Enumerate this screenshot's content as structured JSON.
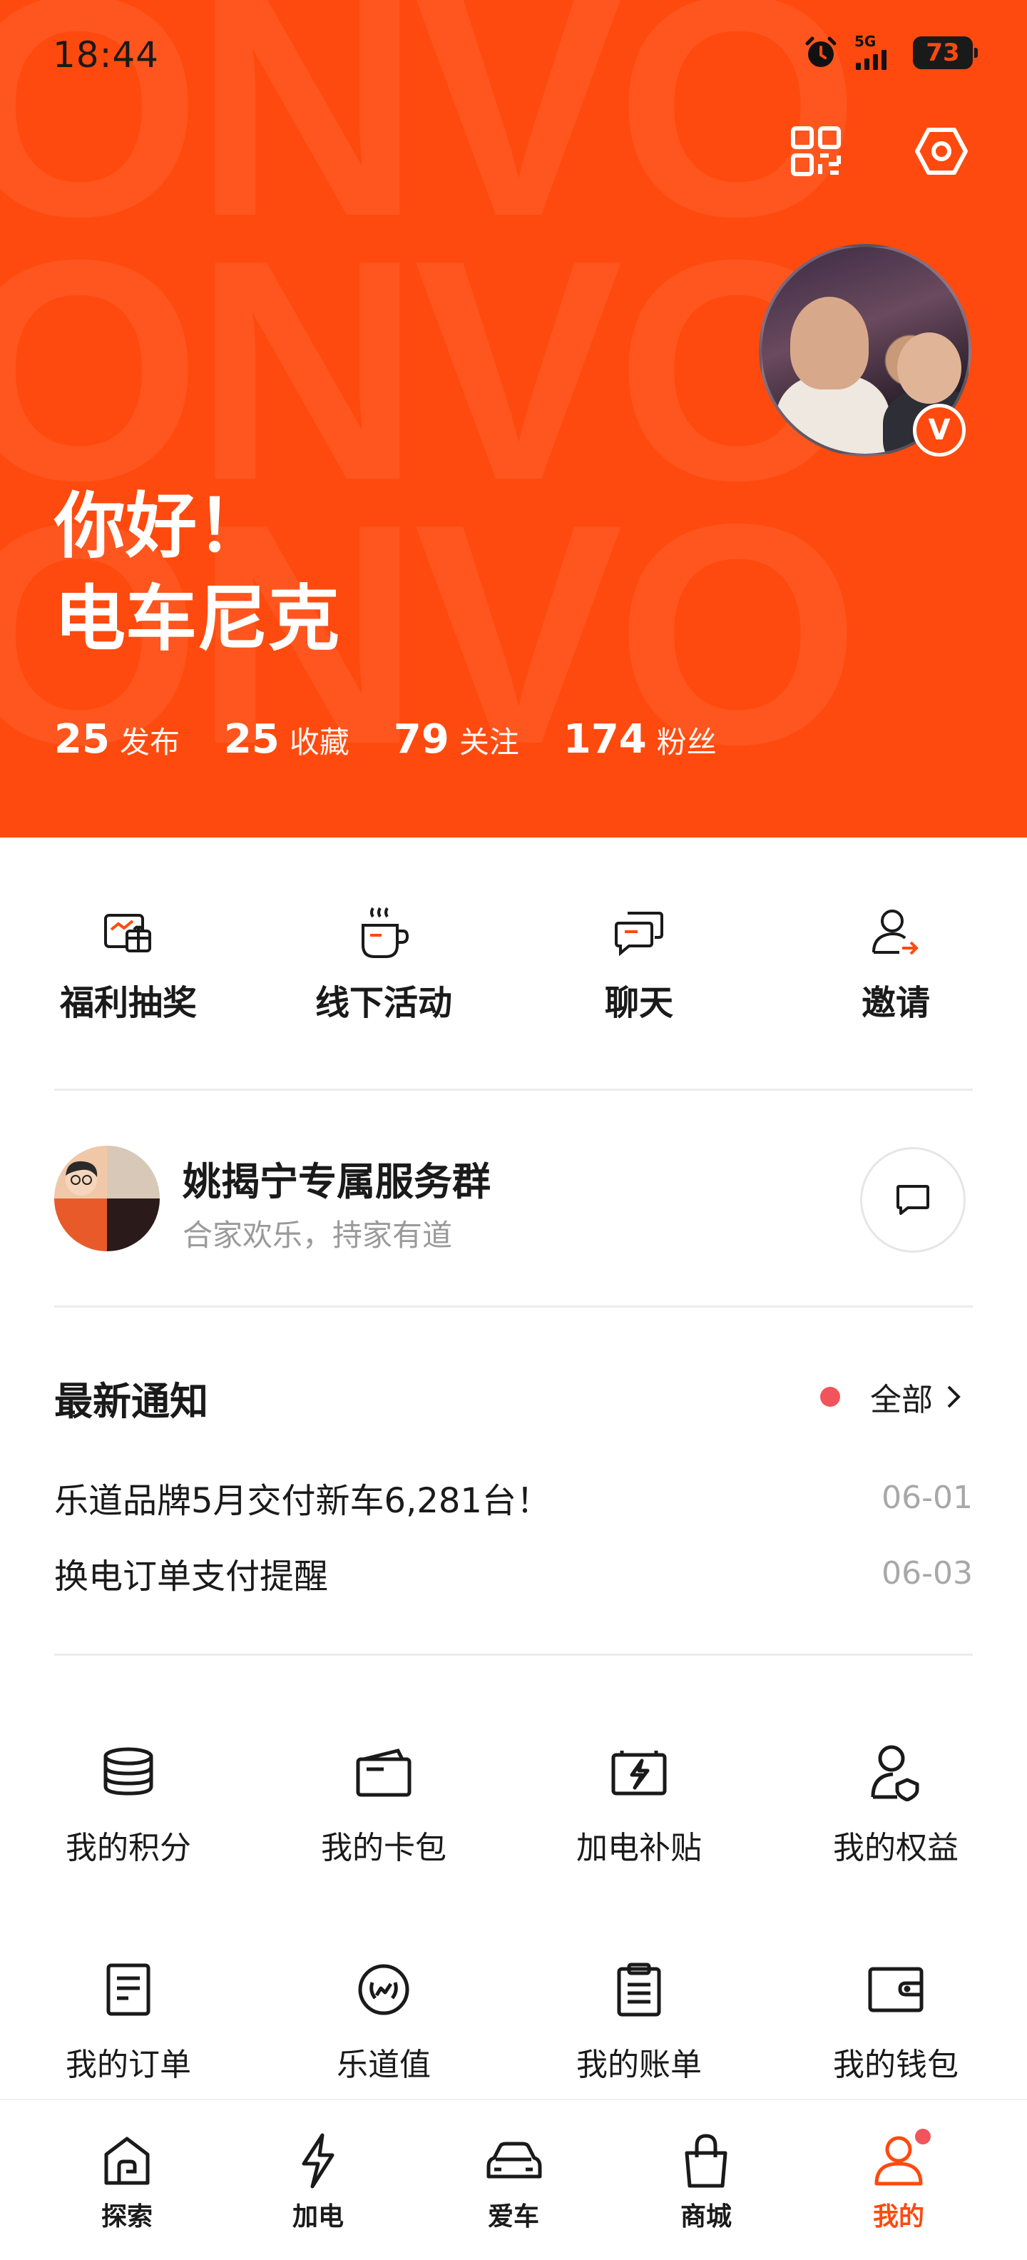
{
  "status_bar": {
    "time": "18:44",
    "network": "5G",
    "battery": "73"
  },
  "header": {
    "greeting": "你好！",
    "username": "电车尼克",
    "watermark": "ONVO"
  },
  "stats": [
    {
      "value": "25",
      "label": "发布"
    },
    {
      "value": "25",
      "label": "收藏"
    },
    {
      "value": "79",
      "label": "关注"
    },
    {
      "value": "174",
      "label": "粉丝"
    }
  ],
  "quick_actions": [
    {
      "label": "福利抽奖",
      "icon": "gift-icon"
    },
    {
      "label": "线下活动",
      "icon": "coffee-icon"
    },
    {
      "label": "聊天",
      "icon": "chat-bubbles-icon"
    },
    {
      "label": "邀请",
      "icon": "invite-user-icon"
    }
  ],
  "service_group": {
    "title": "姚揭宁专属服务群",
    "subtitle": "合家欢乐，持家有道"
  },
  "notices": {
    "title": "最新通知",
    "all_label": "全部",
    "items": [
      {
        "text": "乐道品牌5月交付新车6,281台！",
        "date": "06-01"
      },
      {
        "text": "换电订单支付提醒",
        "date": "06-03"
      }
    ]
  },
  "services": [
    {
      "label": "我的积分",
      "icon": "coins-icon"
    },
    {
      "label": "我的卡包",
      "icon": "card-wallet-icon"
    },
    {
      "label": "加电补贴",
      "icon": "battery-charge-icon"
    },
    {
      "label": "我的权益",
      "icon": "user-shield-icon"
    },
    {
      "label": "我的订单",
      "icon": "order-doc-icon"
    },
    {
      "label": "乐道值",
      "icon": "laurel-badge-icon"
    },
    {
      "label": "我的账单",
      "icon": "clipboard-icon"
    },
    {
      "label": "我的钱包",
      "icon": "wallet-icon"
    }
  ],
  "nav": [
    {
      "label": "探索",
      "icon": "home-icon"
    },
    {
      "label": "加电",
      "icon": "lightning-icon"
    },
    {
      "label": "爱车",
      "icon": "car-icon"
    },
    {
      "label": "商城",
      "icon": "shopping-bag-icon"
    },
    {
      "label": "我的",
      "icon": "profile-icon"
    }
  ],
  "colors": {
    "brand": "#fe4a0e",
    "notice_dot": "#f2545b",
    "muted": "#9a9a9a"
  }
}
